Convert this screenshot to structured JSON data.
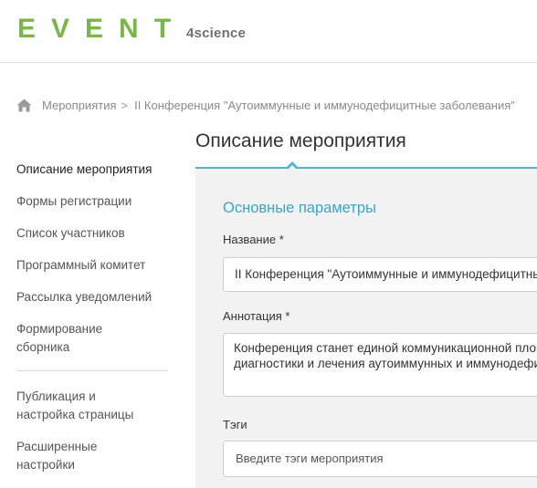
{
  "header": {
    "logo_word": "EVENT",
    "logo_suffix": "4science"
  },
  "breadcrumb": {
    "home_icon": "home-icon",
    "items": [
      "Мероприятия",
      "II Конференция \"Аутоиммунные и иммунодефицитные заболевания\""
    ],
    "separator": ">"
  },
  "sidebar": {
    "items": [
      {
        "label": "Описание мероприятия",
        "active": true
      },
      {
        "label": "Формы регистрации"
      },
      {
        "label": "Список участников"
      },
      {
        "label": "Программный комитет"
      },
      {
        "label": "Рассылка уведомлений"
      },
      {
        "label_lines": [
          "Формирование",
          "сборника"
        ]
      }
    ],
    "items_secondary": [
      {
        "label_lines": [
          "Публикация и",
          "настройка страницы"
        ]
      },
      {
        "label_lines": [
          "Расширенные",
          "настройки"
        ]
      }
    ]
  },
  "main": {
    "title": "Описание мероприятия",
    "section_title": "Основные параметры",
    "name_label": "Название *",
    "name_value": "II Конференция \"Аутоиммунные и иммунодефицитные заболевания\"",
    "annotation_label": "Аннотация *",
    "annotation_lines": [
      "Конференция станет единой коммуникационной площадкой для",
      "диагностики и лечения аутоиммунных и иммунодефицитных"
    ],
    "tags_label": "Тэги",
    "tags_placeholder": "Введите тэги мероприятия"
  },
  "colors": {
    "brand_green": "#7ab648",
    "accent_blue": "#52b5cd",
    "section_blue": "#3aa7c3"
  }
}
